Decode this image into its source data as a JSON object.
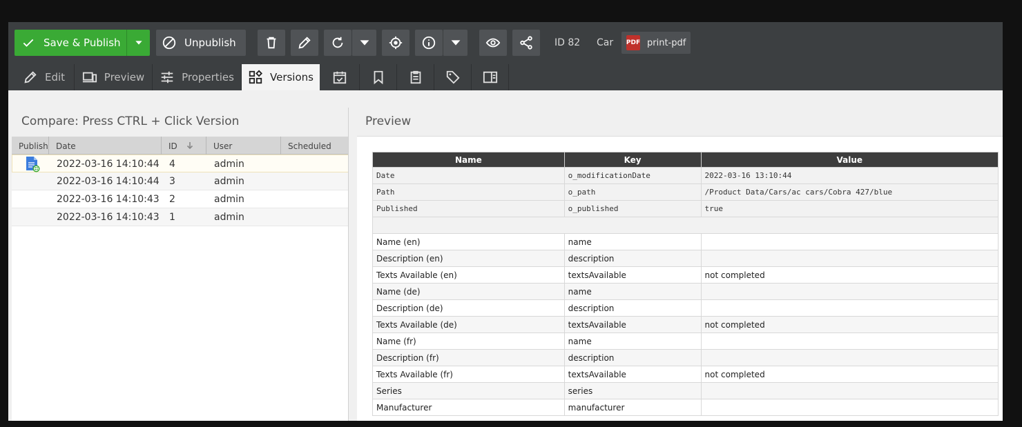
{
  "toolbar": {
    "save_label": "Save & Publish",
    "unpublish_label": "Unpublish",
    "id_label": "ID 82",
    "class_label": "Car",
    "pdf_label": "print-pdf",
    "pdf_icon_text": "PDF"
  },
  "tabs": [
    {
      "label": "Edit"
    },
    {
      "label": "Preview"
    },
    {
      "label": "Properties"
    },
    {
      "label": "Versions"
    }
  ],
  "versions": {
    "title": "Compare: Press CTRL + Click Version",
    "columns": [
      "Publish",
      "Date",
      "ID",
      "User",
      "Scheduled"
    ],
    "rows": [
      {
        "date": "2022-03-16 14:10:44",
        "id": "4",
        "user": "admin"
      },
      {
        "date": "2022-03-16 14:10:44",
        "id": "3",
        "user": "admin"
      },
      {
        "date": "2022-03-16 14:10:43",
        "id": "2",
        "user": "admin"
      },
      {
        "date": "2022-03-16 14:10:43",
        "id": "1",
        "user": "admin"
      }
    ]
  },
  "preview": {
    "title": "Preview",
    "headers": [
      "Name",
      "Key",
      "Value"
    ],
    "system_rows": [
      {
        "name": "Date",
        "key": "o_modificationDate",
        "value": "2022-03-16 13:10:44"
      },
      {
        "name": "Path",
        "key": "o_path",
        "value": "/Product Data/Cars/ac cars/Cobra 427/blue"
      },
      {
        "name": "Published",
        "key": "o_published",
        "value": "true"
      }
    ],
    "field_rows": [
      {
        "name": "Name (en)",
        "key": "name",
        "value": ""
      },
      {
        "name": "Description (en)",
        "key": "description",
        "value": ""
      },
      {
        "name": "Texts Available (en)",
        "key": "textsAvailable",
        "value": "not completed"
      },
      {
        "name": "Name (de)",
        "key": "name",
        "value": ""
      },
      {
        "name": "Description (de)",
        "key": "description",
        "value": ""
      },
      {
        "name": "Texts Available (de)",
        "key": "textsAvailable",
        "value": "not completed"
      },
      {
        "name": "Name (fr)",
        "key": "name",
        "value": ""
      },
      {
        "name": "Description (fr)",
        "key": "description",
        "value": ""
      },
      {
        "name": "Texts Available (fr)",
        "key": "textsAvailable",
        "value": "not completed"
      },
      {
        "name": "Series",
        "key": "series",
        "value": ""
      },
      {
        "name": "Manufacturer",
        "key": "manufacturer",
        "value": ""
      }
    ]
  }
}
